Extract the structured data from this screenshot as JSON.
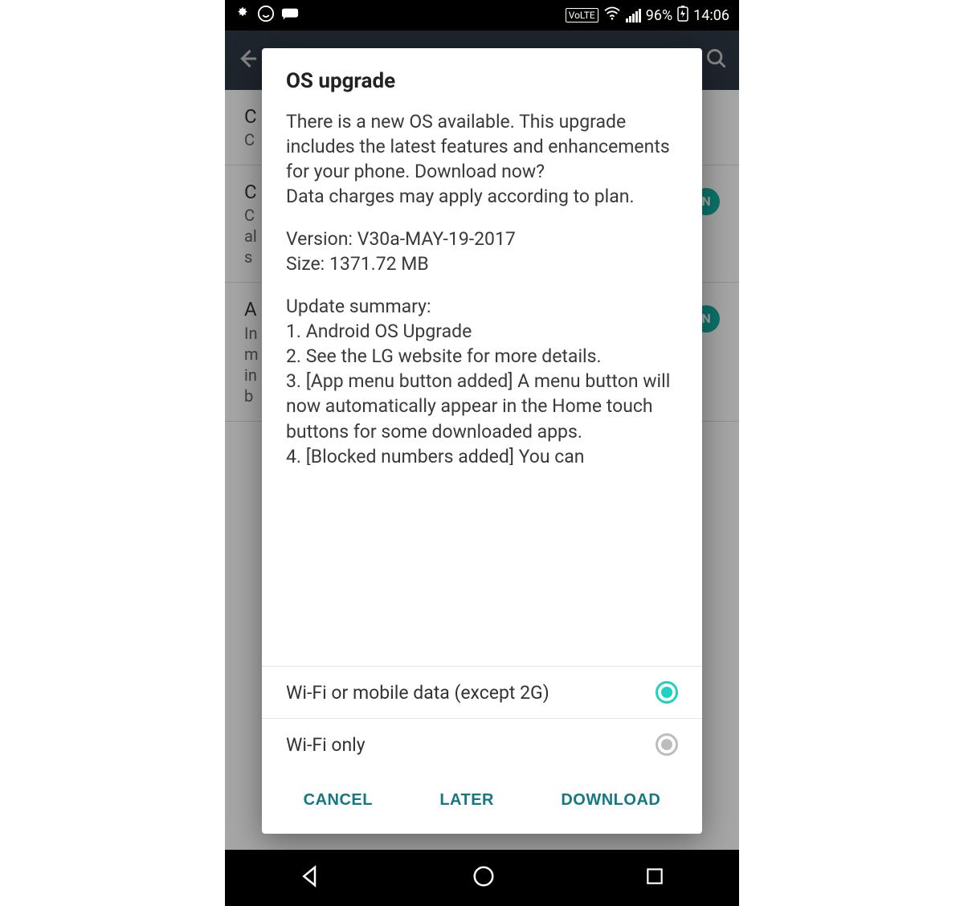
{
  "status": {
    "volte": "VoLTE",
    "battery_pct": "96%",
    "time": "14:06"
  },
  "bg": {
    "row1_title": "C",
    "row1_sub": "C",
    "row2_title": "C",
    "row2_sub1": "C",
    "row2_sub2": "al",
    "row2_sub3": "s",
    "badge": "N",
    "row3_title": "A",
    "row3_sub1": "In",
    "row3_sub2": "m",
    "row3_sub3": "in",
    "row3_sub4": "b"
  },
  "dialog": {
    "title": "OS upgrade",
    "intro": "There is a new OS available. This upgrade includes the latest features and enhancements for your phone. Download now?\nData charges may apply according to plan.",
    "version_label": "Version:",
    "version_value": "V30a-MAY-19-2017",
    "size_label": "Size:",
    "size_value": "1371.72 MB",
    "summary_heading": "Update summary:",
    "summary_1": "1. Android OS Upgrade",
    "summary_2": "2. See the LG website for more details.",
    "summary_3": "3. [App menu button added] A menu button will now automatically appear in the Home touch buttons for some downloaded apps.",
    "summary_4": "4. [Blocked numbers added] You can",
    "options": [
      {
        "label": "Wi-Fi or mobile data (except 2G)",
        "selected": true
      },
      {
        "label": "Wi-Fi only",
        "selected": false
      }
    ],
    "actions": {
      "cancel": "CANCEL",
      "later": "LATER",
      "download": "DOWNLOAD"
    }
  }
}
